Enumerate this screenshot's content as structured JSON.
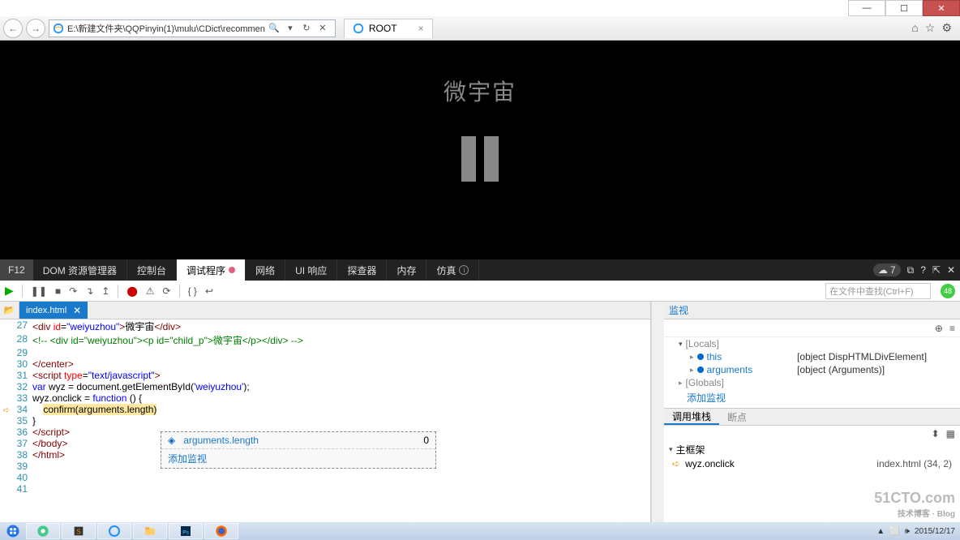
{
  "window": {
    "min": "—",
    "max": "☐",
    "close": "✕"
  },
  "nav": {
    "url": "E:\\新建文件夹\\QQPinyin(1)\\mulu\\CDict\\recommen",
    "tab_title": "ROOT",
    "search_glyph": "🔍",
    "refresh_glyph": "↻",
    "stop_glyph": "✕",
    "home": "⌂",
    "star": "☆",
    "gear": "⚙"
  },
  "page": {
    "heading": "微宇宙"
  },
  "devtabs": {
    "f12": "F12",
    "dom": "DOM 资源管理器",
    "console": "控制台",
    "debugger": "调试程序",
    "network": "网络",
    "ui": "UI 响应",
    "profiler": "探查器",
    "memory": "内存",
    "emulation": "仿真",
    "pill": "7",
    "help": "?",
    "undock": "⧉",
    "close": "✕"
  },
  "dbgbar": {
    "play": "▶",
    "pause": "❚❚",
    "stop": "■",
    "step_over": "↷",
    "step_into": "↴",
    "step_out": "↥",
    "bp_toggle": "⬤",
    "ex": "⚠",
    "rb": "⟳",
    "pretty": "{ }",
    "wrap": "↩",
    "search_ph": "在文件中查找(Ctrl+F)",
    "badge": "48"
  },
  "filetab": {
    "name": "index.html",
    "close": "✕",
    "folder": "📂"
  },
  "code": {
    "lines": [
      {
        "n": 27,
        "html": "<span class='tag'>&lt;div</span> <span class='attr'>id</span>=<span class='str'>\"weiyuzhou\"</span><span class='tag'>&gt;</span>微宇宙<span class='tag'>&lt;/div&gt;</span>"
      },
      {
        "n": 28,
        "html": "<span class='cmt'>&lt;!-- &lt;div id=\"weiyuzhou\"&gt;&lt;p id=\"child_p\"&gt;微宇宙&lt;/p&gt;&lt;/div&gt; --&gt;</span>"
      },
      {
        "n": 29,
        "html": ""
      },
      {
        "n": 30,
        "html": "<span class='tag'>&lt;/center&gt;</span>"
      },
      {
        "n": 31,
        "html": "<span class='tag'>&lt;script</span> <span class='attr'>type</span>=<span class='str'>\"text/javascript\"</span><span class='tag'>&gt;</span>"
      },
      {
        "n": 32,
        "html": "<span class='kw'>var</span> wyz = document.getElementById(<span class='str'>'weiyuzhou'</span>);"
      },
      {
        "n": 33,
        "html": "wyz.onclick = <span class='kw'>function</span> () {"
      },
      {
        "n": 34,
        "bp": true,
        "html": "    <span class='hl-bp'>confirm(arguments.length)</span>"
      },
      {
        "n": 35,
        "html": "}"
      },
      {
        "n": 36,
        "html": "<span class='tag'>&lt;/script&gt;</span>"
      },
      {
        "n": 37,
        "html": "<span class='tag'>&lt;/body&gt;</span>"
      },
      {
        "n": 38,
        "html": "<span class='tag'>&lt;/html&gt;</span>"
      },
      {
        "n": 39,
        "html": ""
      },
      {
        "n": 40,
        "html": ""
      },
      {
        "n": 41,
        "html": ""
      }
    ]
  },
  "popup": {
    "expr": "arguments.length",
    "val": "0",
    "add": "添加监视"
  },
  "watch": {
    "hdr": "监视",
    "add_icon": "⚬",
    "del_icon": "≡",
    "locals": "[Locals]",
    "this": "this",
    "this_val": "[object DispHTMLDivElement]",
    "args": "arguments",
    "args_val": "[object (Arguments)]",
    "globals": "[Globals]",
    "add": "添加监视"
  },
  "stack": {
    "tab1": "调用堆栈",
    "tab2": "断点",
    "group": "主框架",
    "fn": "wyz.onclick",
    "loc": "index.html (34, 2)"
  },
  "tray": {
    "date": "2015/12/17"
  },
  "wm": {
    "t": "51CTO.com",
    "s": "技术博客 · Blog"
  }
}
